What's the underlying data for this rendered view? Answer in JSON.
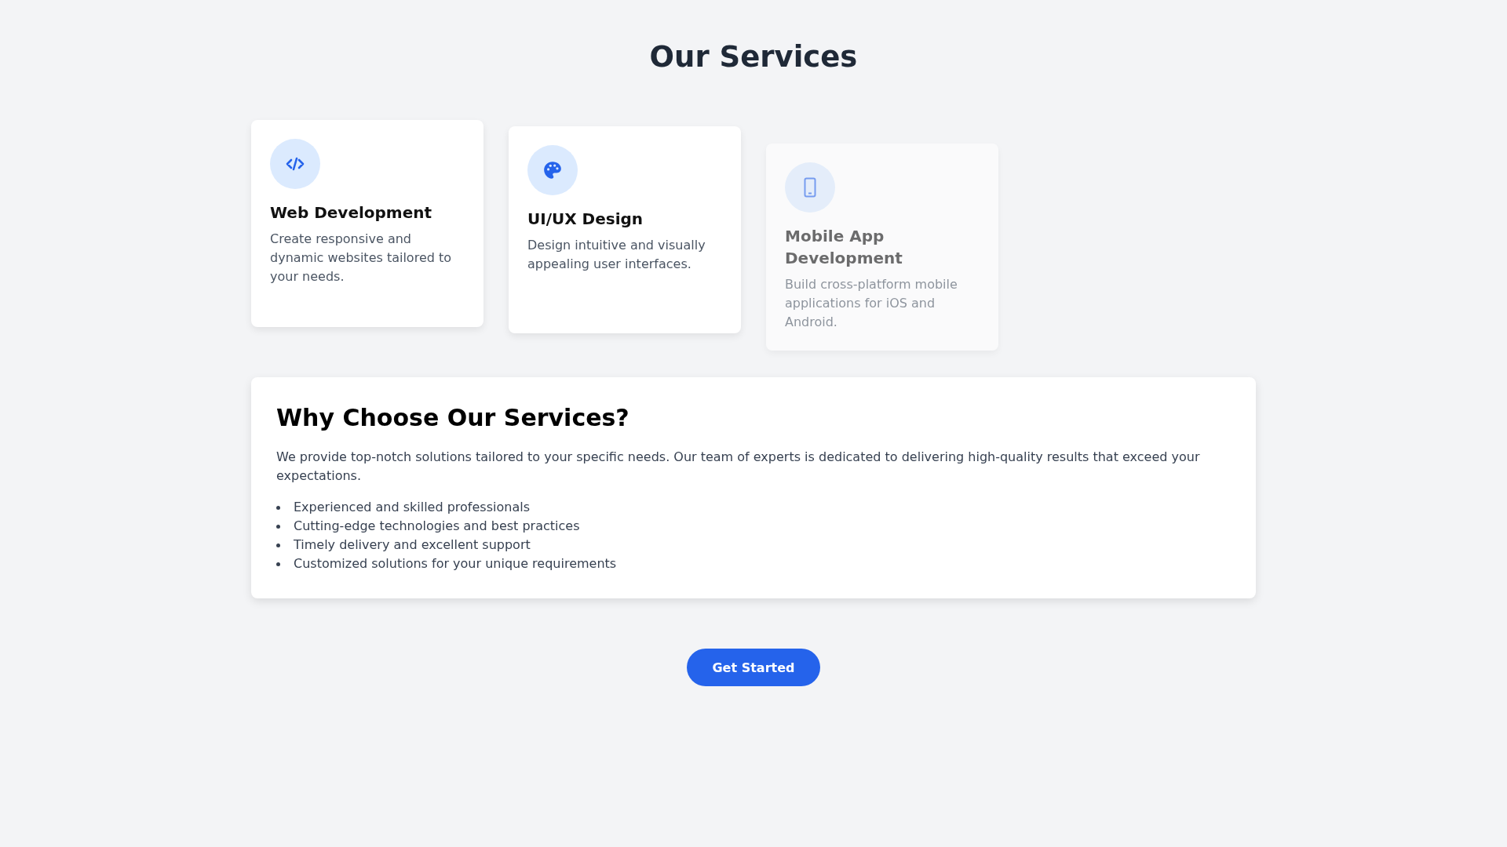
{
  "title": "Our Services",
  "services": [
    {
      "kind": "code",
      "title": "Web Development",
      "description": "Create responsive and dynamic websites tailored to your needs.",
      "faded": false
    },
    {
      "kind": "palette",
      "title": "UI/UX Design",
      "description": "Design intuitive and visually appealing user interfaces.",
      "faded": false
    },
    {
      "kind": "phone",
      "title": "Mobile App Development",
      "description": "Build cross-platform mobile applications for iOS and Android.",
      "faded": true
    }
  ],
  "why": {
    "heading": "Why Choose Our Services?",
    "text": "We provide top-notch solutions tailored to your specific needs. Our team of experts is dedicated to delivering high-quality results that exceed your expectations.",
    "points": [
      "Experienced and skilled professionals",
      "Cutting-edge technologies and best practices",
      "Timely delivery and excellent support",
      "Customized solutions for your unique requirements"
    ]
  },
  "button": "Get Started"
}
